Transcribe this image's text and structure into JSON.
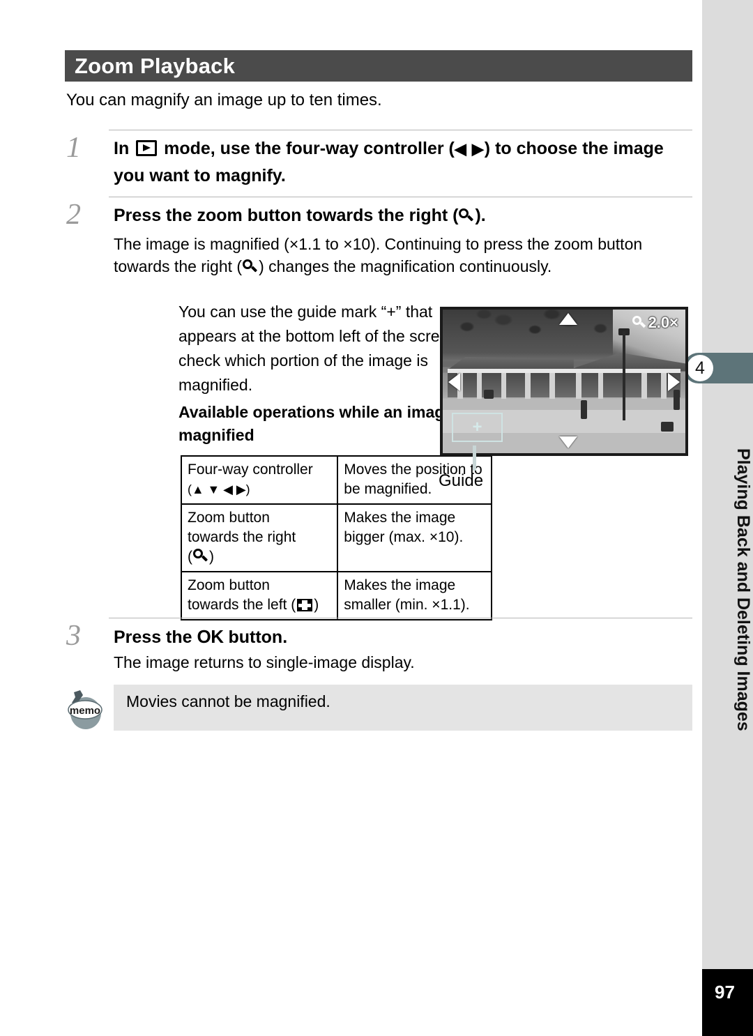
{
  "document": {
    "section_title": "Zoom Playback",
    "intro": "You can magnify an image up to ten times.",
    "page_number": "97"
  },
  "chapter": {
    "number": "4",
    "title": "Playing Back and Deleting Images"
  },
  "steps": [
    {
      "number": "1",
      "title_before_icon": "In ",
      "icon": "playback-mode-icon",
      "title_after_icon": " mode, use the four-way controller (",
      "arrows": "◀ ▶",
      "title_tail": ") to choose the image you want to magnify.",
      "body": ""
    },
    {
      "number": "2",
      "title_before_icon": "Press the zoom button towards the right (",
      "icon": "magnify-icon",
      "title_tail": ").",
      "body_part1": "The image is magnified (×1.1 to ×10). Continuing to press the zoom button towards the right (",
      "body_part2": ") changes the magnification continuously."
    },
    {
      "number": "3",
      "title_before_icon": "Press the ",
      "icon": "ok-button-icon",
      "ok_label": "OK",
      "title_tail": " button.",
      "body": "The image returns to single-image display."
    }
  ],
  "guide_paragraph": "You can use the guide mark “+” that appears at the bottom left of the screen to check which portion of the image is magnified.",
  "operations": {
    "subhead": "Available operations while an image is magnified",
    "rows": [
      {
        "control_line1": "Four-way controller",
        "control_arrows": "(▲ ▼ ◀ ▶)",
        "control_icon": "",
        "action": "Moves the position to be magnified."
      },
      {
        "control_line1": "Zoom button",
        "control_line2": "towards the right",
        "control_arrows": "",
        "control_icon": "magnify-icon",
        "control_paren_open": "(",
        "control_paren_close": ")",
        "action": "Makes the image bigger (max. ×10)."
      },
      {
        "control_line1": "Zoom button",
        "control_line2": "towards the left ",
        "control_arrows": "",
        "control_icon": "thumbnail-icon",
        "control_paren_open": "(",
        "control_paren_close": ")",
        "action": "Makes the image smaller (min. ×1.1)."
      }
    ]
  },
  "camera_screen": {
    "zoom_indicator": "2.0×",
    "zoom_icon": "magnify-icon",
    "guide_mark": "+",
    "guide_caption": "Guide",
    "osd_arrows": [
      "up",
      "down",
      "left",
      "right"
    ]
  },
  "memo": {
    "icon_label": "memo",
    "text": "Movies cannot be magnified."
  },
  "colors": {
    "header_bar": "#4b4b4b",
    "chapter_rail": "#dcdcdc",
    "chapter_tab": "#5d7479",
    "memo_bg": "#e4e4e4",
    "step_number": "#9a9a9a",
    "guide_box": "#cfe3e3",
    "page_number_bg": "#000000"
  }
}
